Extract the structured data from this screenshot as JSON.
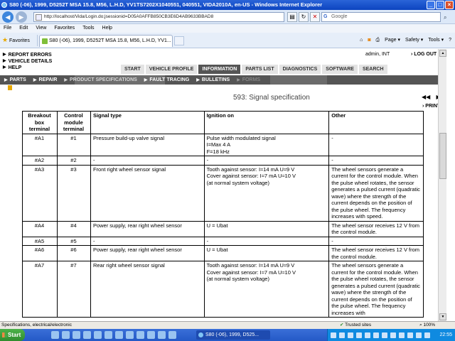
{
  "window": {
    "title": "S80 (-06), 1999, D5252T MSA 15.8, M56, L.H.D, YV1TS7202X1040551, 040551, VIDA2010A, en-US - Windows Internet Explorer"
  },
  "browser": {
    "address": "http://localhost/Vida/Login.do;jsessionid=D05A0AFFB850CB3E6D4AB9633BBAD8",
    "search_placeholder": "Google",
    "menu": [
      "File",
      "Edit",
      "View",
      "Favorites",
      "Tools",
      "Help"
    ],
    "favorites_label": "Favorites",
    "tab_label": "S80 (-06), 1999, D5252T MSA 15.8, M56, L.H.D, YV1...",
    "cmd": {
      "page": "Page ▾",
      "safety": "Safety ▾",
      "tools": "Tools ▾",
      "help": "?"
    }
  },
  "app": {
    "left_links": [
      "REPORT ERRORS",
      "VEHICLE DETAILS",
      "HELP"
    ],
    "user": "admin, INT",
    "logout": "LOG OUT",
    "top_tabs": [
      {
        "label": "START",
        "active": false
      },
      {
        "label": "VEHICLE PROFILE",
        "active": false
      },
      {
        "label": "INFORMATION",
        "active": true
      },
      {
        "label": "PARTS LIST",
        "active": false
      },
      {
        "label": "DIAGNOSTICS",
        "active": false
      },
      {
        "label": "SOFTWARE",
        "active": false
      },
      {
        "label": "SEARCH",
        "active": false
      }
    ],
    "subnav": [
      "PARTS",
      "REPAIR",
      "PRODUCT SPECIFICATIONS",
      "FAULT TRACING",
      "BULLETINS",
      "FORMS"
    ],
    "page_title": "593: Signal specification",
    "print_label": "PRINT",
    "table": {
      "headers": [
        "Breakout box terminal",
        "Control module terminal",
        "Signal type",
        "Ignition on",
        "Other"
      ],
      "rows": [
        [
          "#A1",
          "#1",
          "Pressure build-up valve signal",
          "Pulse width modulated signal\nI=Max 4 A\nF=18 kHz",
          "-"
        ],
        [
          "#A2",
          "#2",
          "-",
          "-",
          "-"
        ],
        [
          "#A3",
          "#3",
          "Front right wheel sensor signal",
          "Tooth against sensor: I≈14 mA U≈9 V\nCover against sensor: I≈7 mA U≈10 V\n(at normal system voltage)",
          "The wheel sensors generate a current for the control module. When the pulse wheel rotates, the sensor generates a pulsed current (quadratic wave) where the strength of the current depends on the position of the pulse wheel. The frequency increases with speed."
        ],
        [
          "#A4",
          "#4",
          "Power supply, rear right wheel sensor",
          "U = Ubat",
          "The wheel sensor receives 12 V from the control module."
        ],
        [
          "#A5",
          "#5",
          "-",
          "-",
          "-"
        ],
        [
          "#A6",
          "#6",
          "Power supply, rear right wheel sensor",
          "U = Ubat",
          "The wheel sensor receives 12 V from the control module."
        ],
        [
          "#A7",
          "#7",
          "Rear right wheel sensor signal",
          "Tooth against sensor: I≈14 mA U≈9 V\nCover against sensor: I≈7 mA U≈10 V\n(at normal system voltage)",
          "The wheel sensors generate a current for the control module. When the pulse wheel rotates, the sensor generates a pulsed current (quadratic wave) where the strength of the current depends on the position of the pulse wheel. The frequency increases with"
        ]
      ]
    }
  },
  "status": {
    "text": "Specifications, electrical/electronic",
    "zone": "Trusted sites",
    "zoom": "100%"
  },
  "taskbar": {
    "start": "Start",
    "item": "S80 (-06), 1999, D525...",
    "clock": "22:55"
  }
}
